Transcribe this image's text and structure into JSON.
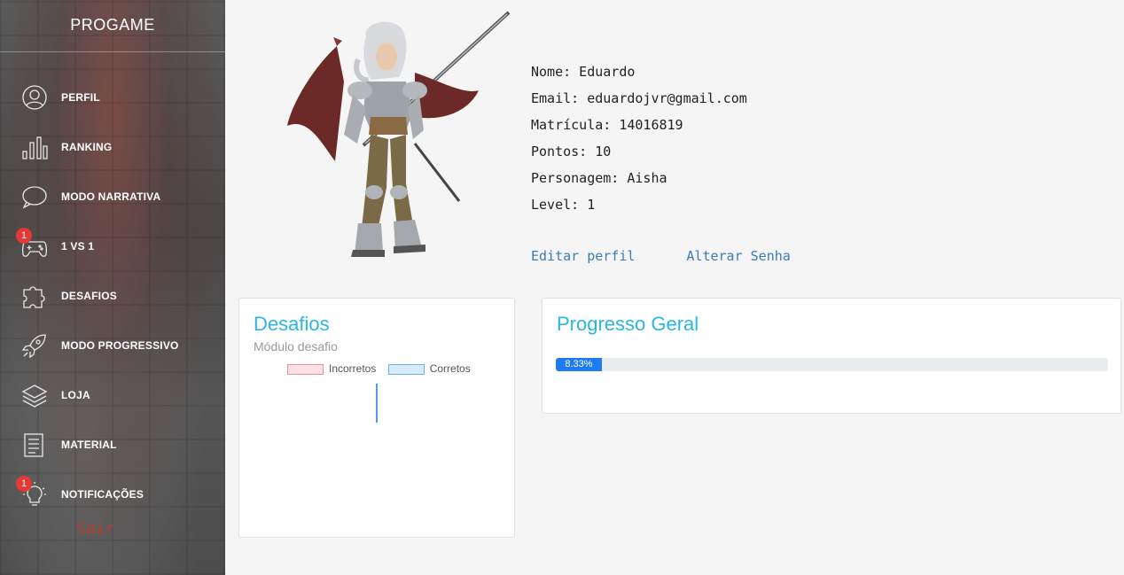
{
  "brand": "PROGAME",
  "nav": [
    {
      "label": "PERFIL",
      "icon": "user-icon"
    },
    {
      "label": "RANKING",
      "icon": "bar-chart-icon"
    },
    {
      "label": "MODO NARRATIVA",
      "icon": "speech-bubble-icon"
    },
    {
      "label": "1 VS 1",
      "icon": "gamepad-icon",
      "badge": "1"
    },
    {
      "label": "DESAFIOS",
      "icon": "puzzle-icon"
    },
    {
      "label": "MODO PROGRESSIVO",
      "icon": "rocket-icon"
    },
    {
      "label": "LOJA",
      "icon": "layers-icon"
    },
    {
      "label": "MATERIAL",
      "icon": "document-icon"
    },
    {
      "label": "NOTIFICAÇÕES",
      "icon": "lightbulb-icon",
      "badge": "1"
    }
  ],
  "logout_label": "Sair",
  "profile": {
    "nome": "Nome: Eduardo",
    "email": "Email: eduardojvr@gmail.com",
    "matricula": "Matrícula: 14016819",
    "pontos": "Pontos: 10",
    "personagem": "Personagem: Aisha",
    "level": "Level: 1",
    "edit_label": "Editar perfil",
    "password_label": "Alterar Senha"
  },
  "desafios_card": {
    "title": "Desafios",
    "subtitle": "Módulo desafio"
  },
  "chart_data": {
    "type": "bar",
    "series": [
      {
        "name": "Incorretos",
        "color": "#f28aa0"
      },
      {
        "name": "Corretos",
        "color": "#6cb3e8"
      }
    ]
  },
  "progress_card": {
    "title": "Progresso Geral",
    "value_label": "8.33%",
    "value": 8.33
  },
  "colors": {
    "accent": "#29b6e8",
    "link": "#3a7bb6",
    "progress": "#1e7cf2",
    "badge": "#e53935"
  }
}
